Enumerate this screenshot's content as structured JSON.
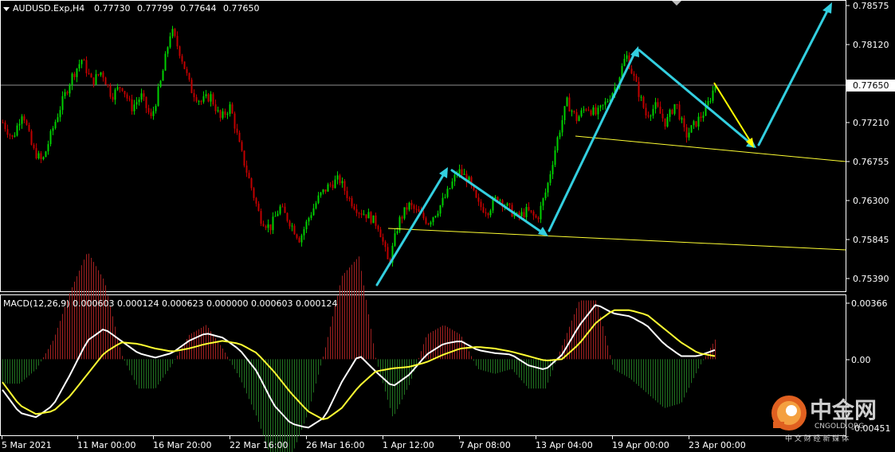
{
  "chart": {
    "symbol_header": "AUDUSD.Exp,H4",
    "ohlc": [
      "0.77730",
      "0.77799",
      "0.77644",
      "0.77650"
    ],
    "dropdown_icon": "triangle-down-icon",
    "current_price": "0.77650",
    "colors": {
      "background": "#000000",
      "bull": "#00d000",
      "bear": "#c00000",
      "price_box": "#ffffff",
      "arrow": "#33cfe0",
      "trendline": "#ffff33",
      "yellow_arrow": "#ffff00",
      "macd_line": "#ffffff",
      "signal_line": "#ffff33",
      "hist_pos": "#a02020",
      "hist_neg": "#207020"
    }
  },
  "macd": {
    "header": "MACD(12,26,9) 0.000603 0.000124 0.000623 0.000000 0.000603 0.000124",
    "axis": [
      "0.00366",
      "0.00",
      "-0.00451"
    ]
  },
  "watermark": {
    "logo_icon": "cngold-logo-icon",
    "title": "中金网",
    "domain": "CNGOLD.ORG",
    "subtitle": "中 文 财 经 新 媒 体"
  },
  "chart_data": {
    "type": "candlestick",
    "instrument": "AUDUSD.Exp",
    "timeframe": "H4",
    "price_axis": [
      "0.78575",
      "0.78120",
      "0.77650",
      "0.77210",
      "0.76755",
      "0.76300",
      "0.75845",
      "0.75390"
    ],
    "x_labels": [
      "5 Mar 2021",
      "11 Mar 00:00",
      "16 Mar 20:00",
      "22 Mar 16:00",
      "26 Mar 16:00",
      "1 Apr 12:00",
      "7 Apr 08:00",
      "13 Apr 04:00",
      "19 Apr 00:00",
      "23 Apr 00:00"
    ],
    "price_path": [
      0.7721,
      0.7702,
      0.7735,
      0.769,
      0.7675,
      0.7712,
      0.7745,
      0.7775,
      0.7795,
      0.7768,
      0.7781,
      0.7752,
      0.7765,
      0.7738,
      0.7752,
      0.7725,
      0.777,
      0.783,
      0.78,
      0.776,
      0.7745,
      0.7752,
      0.7725,
      0.774,
      0.769,
      0.765,
      0.761,
      0.7598,
      0.7622,
      0.7605,
      0.7585,
      0.7612,
      0.7635,
      0.7648,
      0.7655,
      0.7632,
      0.7618,
      0.7612,
      0.76,
      0.7555,
      0.7605,
      0.7625,
      0.7615,
      0.7605,
      0.762,
      0.764,
      0.7665,
      0.7655,
      0.7625,
      0.7618,
      0.7635,
      0.7622,
      0.761,
      0.7618,
      0.7608,
      0.7645,
      0.77,
      0.7745,
      0.7725,
      0.774,
      0.773,
      0.7745,
      0.7765,
      0.78,
      0.7765,
      0.773,
      0.774,
      0.772,
      0.7745,
      0.7705,
      0.772,
      0.7735,
      0.7765
    ],
    "macd_path": [
      -0.002,
      -0.0035,
      -0.0038,
      -0.003,
      -0.001,
      0.0012,
      0.002,
      0.0012,
      0.0004,
      0.0001,
      0.0004,
      0.0012,
      0.0017,
      0.0014,
      0.0006,
      -0.0008,
      -0.003,
      -0.0042,
      -0.0045,
      -0.0038,
      -0.0015,
      0.0003,
      -0.0008,
      -0.0018,
      -0.001,
      0.0003,
      0.001,
      0.0012,
      0.0006,
      0.0004,
      0.0003,
      -0.0004,
      -0.0007,
      0.0003,
      0.0022,
      0.0036,
      0.003,
      0.0028,
      0.0022,
      0.001,
      0.0002,
      0.0002,
      0.0006
    ],
    "signal_path": [
      -0.0015,
      -0.003,
      -0.0036,
      -0.0034,
      -0.0024,
      -0.001,
      0.0004,
      0.0011,
      0.001,
      0.0007,
      0.0005,
      0.0007,
      0.001,
      0.0012,
      0.001,
      0.0004,
      -0.0008,
      -0.0022,
      -0.0034,
      -0.004,
      -0.0032,
      -0.0018,
      -0.0008,
      -0.0006,
      -0.0005,
      -0.0002,
      0.0003,
      0.0007,
      0.0008,
      0.0007,
      0.0005,
      0.0002,
      -0.0001,
      0.0,
      0.001,
      0.0024,
      0.0032,
      0.0032,
      0.0029,
      0.002,
      0.0011,
      0.0004,
      0.0002
    ],
    "macd_range": [
      -0.00451,
      0.00366
    ]
  }
}
